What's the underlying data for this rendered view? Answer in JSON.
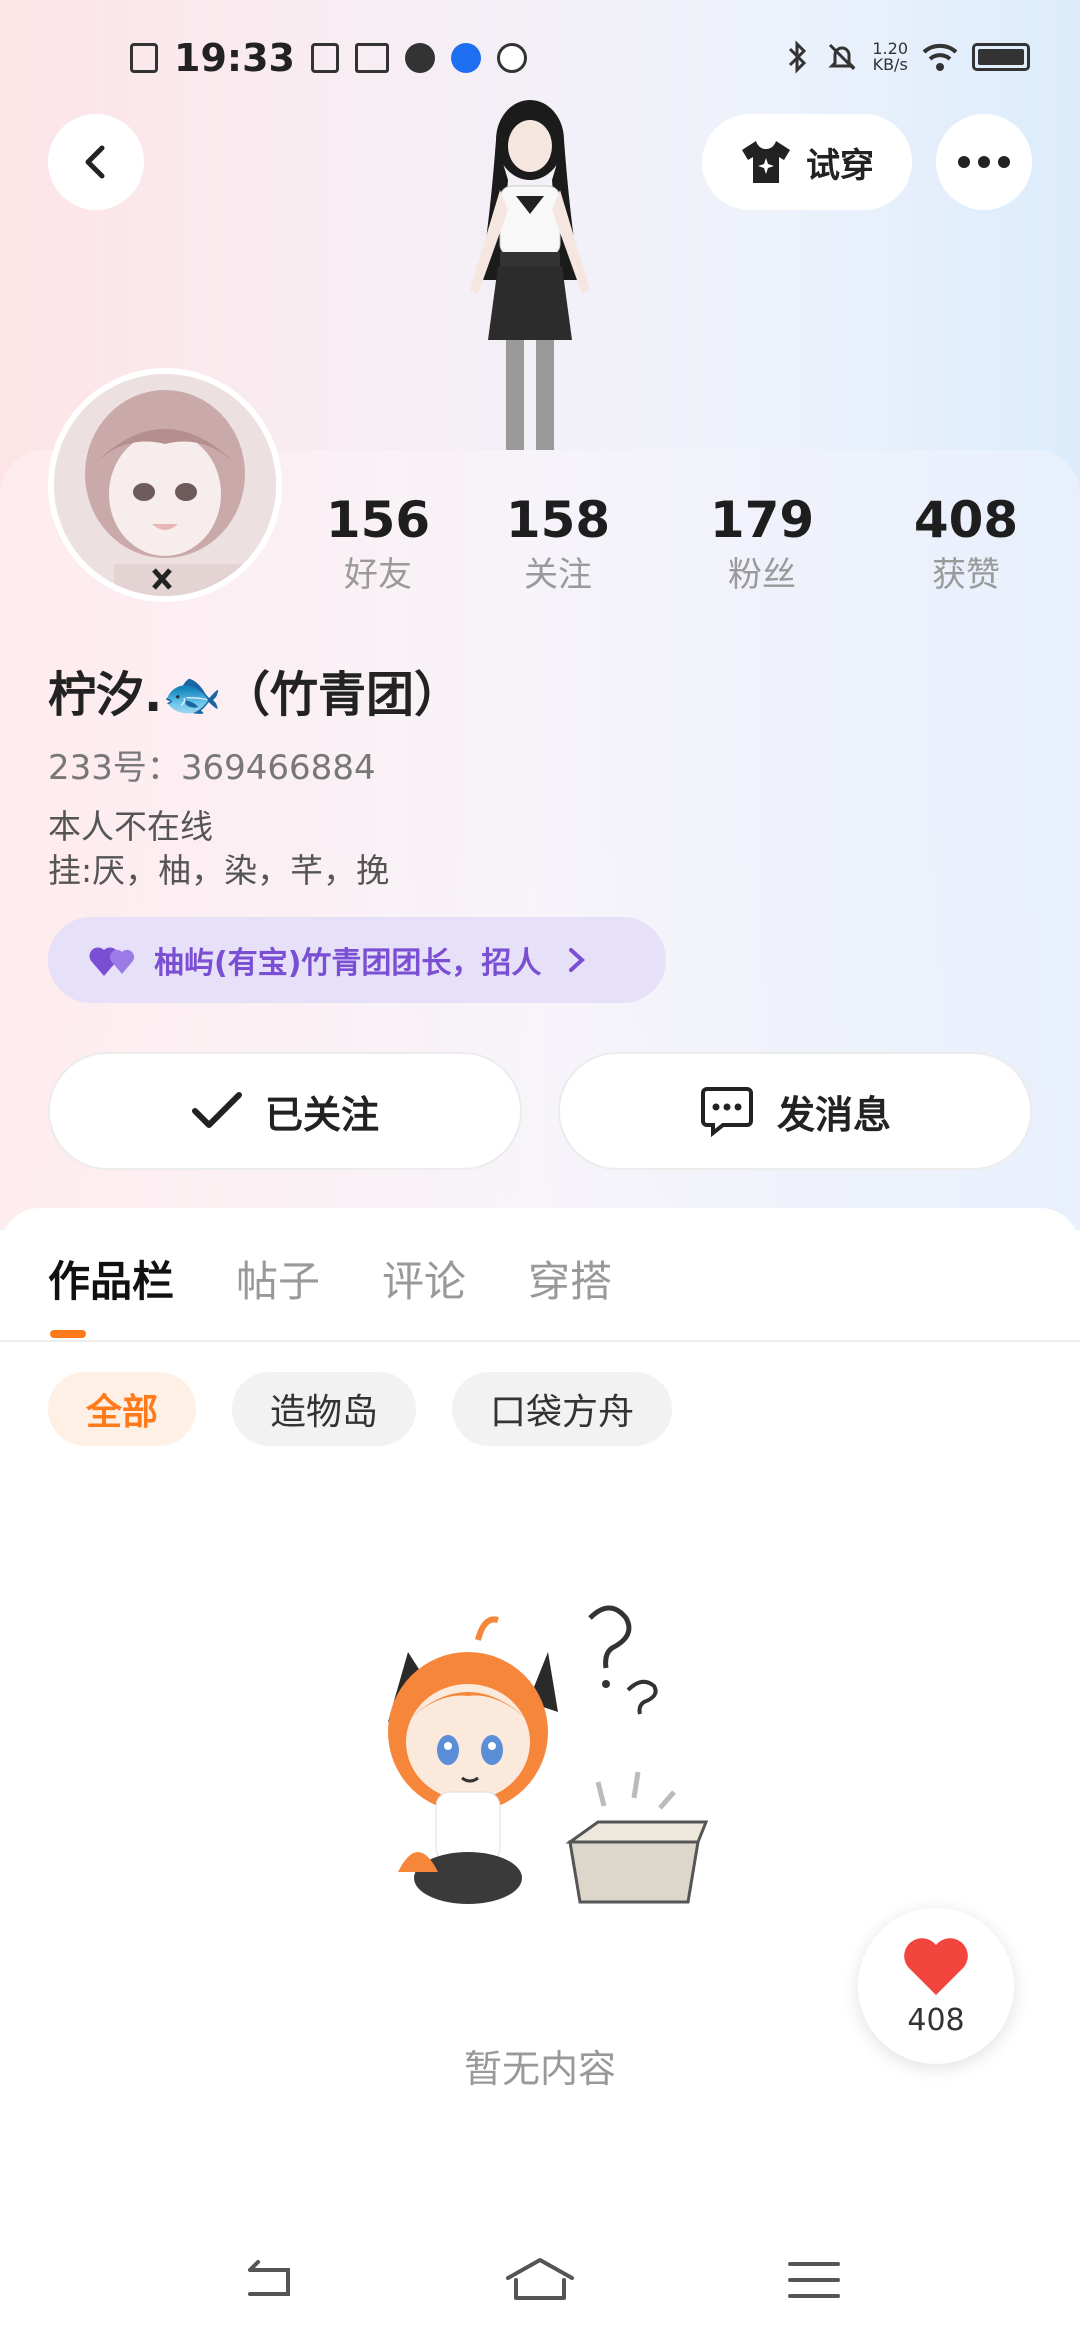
{
  "status_bar": {
    "time": "19:33",
    "net_speed_value": "1.20",
    "net_speed_unit": "KB/s"
  },
  "header": {
    "try_on_label": "试穿"
  },
  "profile": {
    "name": "柠汐.🐟（竹青团）",
    "uid": "233号：369466884",
    "bio_line1": "本人不在线",
    "bio_line2": "挂:厌，柚，染，芊，挽",
    "guild": "柚屿(有宝)竹青团团长，招人"
  },
  "stats": [
    {
      "num": "156",
      "label": "好友"
    },
    {
      "num": "158",
      "label": "关注"
    },
    {
      "num": "179",
      "label": "粉丝"
    },
    {
      "num": "408",
      "label": "获赞"
    }
  ],
  "actions": {
    "follow_label": "已关注",
    "message_label": "发消息"
  },
  "tabs": [
    {
      "label": "作品栏",
      "active": true
    },
    {
      "label": "帖子",
      "active": false
    },
    {
      "label": "评论",
      "active": false
    },
    {
      "label": "穿搭",
      "active": false
    }
  ],
  "chips": [
    {
      "label": "全部",
      "active": true
    },
    {
      "label": "造物岛",
      "active": false
    },
    {
      "label": "口袋方舟",
      "active": false
    }
  ],
  "empty": {
    "text": "暂无内容"
  },
  "like": {
    "count": "408"
  },
  "colors": {
    "accent": "#ff7a1a",
    "guild_text": "#7a4fd3",
    "guild_bg": "#e6e0f8"
  }
}
